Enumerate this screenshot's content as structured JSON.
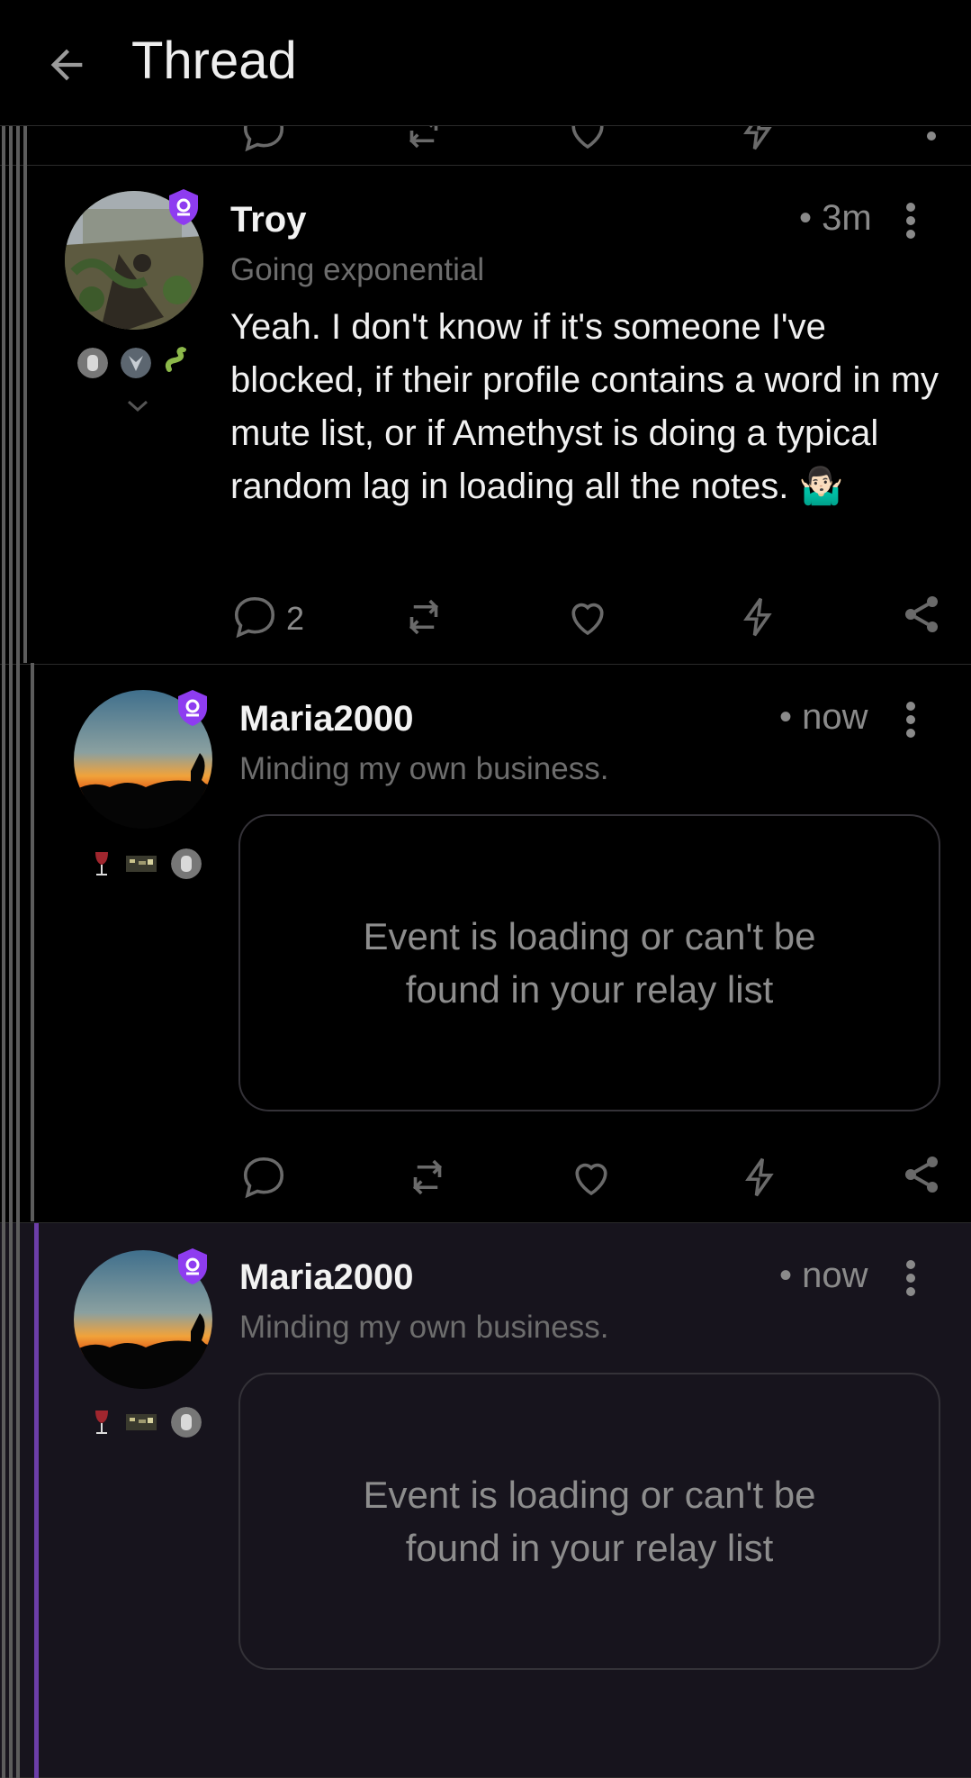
{
  "header": {
    "title": "Thread",
    "back_icon": "arrow-left-icon"
  },
  "posts": [
    {
      "author": "Troy",
      "about": "Going exponential",
      "time": "• 3m",
      "content": "Yeah. I don't know if it's someone I've blocked, if their profile contains a word in my mute list, or if Amethyst is doing a typical random lag in loading all the notes. 🤷🏻‍♂️",
      "reply_count": "2"
    },
    {
      "author": "Maria2000",
      "about": "Minding my own business.",
      "time": "• now",
      "embed_text": "Event is loading or can't be found in your relay list"
    },
    {
      "author": "Maria2000",
      "about": "Minding my own business.",
      "time": "• now",
      "embed_text": "Event is loading or can't be found in your relay list"
    }
  ],
  "colors": {
    "background": "#000000",
    "highlight_background": "#17141d",
    "accent_purple": "#8e3cf0",
    "muted_text": "#6d6d6d"
  }
}
